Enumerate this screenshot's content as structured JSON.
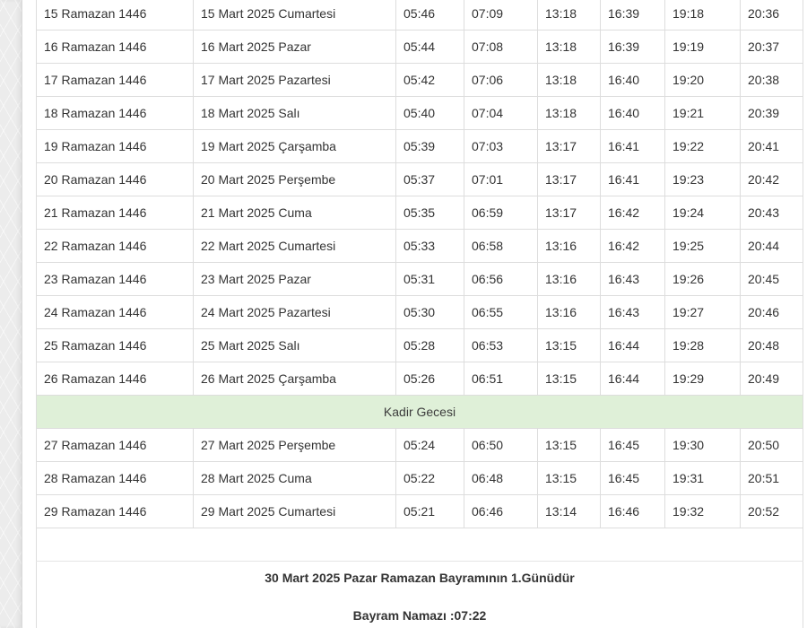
{
  "table": {
    "rows_before_event": [
      [
        "15 Ramazan 1446",
        "15 Mart 2025 Cumartesi",
        "05:46",
        "07:09",
        "13:18",
        "16:39",
        "19:18",
        "20:36"
      ],
      [
        "16 Ramazan 1446",
        "16 Mart 2025 Pazar",
        "05:44",
        "07:08",
        "13:18",
        "16:39",
        "19:19",
        "20:37"
      ],
      [
        "17 Ramazan 1446",
        "17 Mart 2025 Pazartesi",
        "05:42",
        "07:06",
        "13:18",
        "16:40",
        "19:20",
        "20:38"
      ],
      [
        "18 Ramazan 1446",
        "18 Mart 2025 Salı",
        "05:40",
        "07:04",
        "13:18",
        "16:40",
        "19:21",
        "20:39"
      ],
      [
        "19 Ramazan 1446",
        "19 Mart 2025 Çarşamba",
        "05:39",
        "07:03",
        "13:17",
        "16:41",
        "19:22",
        "20:41"
      ],
      [
        "20 Ramazan 1446",
        "20 Mart 2025 Perşembe",
        "05:37",
        "07:01",
        "13:17",
        "16:41",
        "19:23",
        "20:42"
      ],
      [
        "21 Ramazan 1446",
        "21 Mart 2025 Cuma",
        "05:35",
        "06:59",
        "13:17",
        "16:42",
        "19:24",
        "20:43"
      ],
      [
        "22 Ramazan 1446",
        "22 Mart 2025 Cumartesi",
        "05:33",
        "06:58",
        "13:16",
        "16:42",
        "19:25",
        "20:44"
      ],
      [
        "23 Ramazan 1446",
        "23 Mart 2025 Pazar",
        "05:31",
        "06:56",
        "13:16",
        "16:43",
        "19:26",
        "20:45"
      ],
      [
        "24 Ramazan 1446",
        "24 Mart 2025 Pazartesi",
        "05:30",
        "06:55",
        "13:16",
        "16:43",
        "19:27",
        "20:46"
      ],
      [
        "25 Ramazan 1446",
        "25 Mart 2025 Salı",
        "05:28",
        "06:53",
        "13:15",
        "16:44",
        "19:28",
        "20:48"
      ],
      [
        "26 Ramazan 1446",
        "26 Mart 2025 Çarşamba",
        "05:26",
        "06:51",
        "13:15",
        "16:44",
        "19:29",
        "20:49"
      ]
    ],
    "event_label": "Kadir Gecesi",
    "rows_after_event": [
      [
        "27 Ramazan 1446",
        "27 Mart 2025 Perşembe",
        "05:24",
        "06:50",
        "13:15",
        "16:45",
        "19:30",
        "20:50"
      ],
      [
        "28 Ramazan 1446",
        "28 Mart 2025 Cuma",
        "05:22",
        "06:48",
        "13:15",
        "16:45",
        "19:31",
        "20:51"
      ],
      [
        "29 Ramazan 1446",
        "29 Mart 2025 Cumartesi",
        "05:21",
        "06:46",
        "13:14",
        "16:46",
        "19:32",
        "20:52"
      ]
    ]
  },
  "notice": {
    "bayram_line": "30 Mart 2025 Pazar Ramazan Bayramının 1.Günüdür",
    "namaz_line": "Bayram Namazı :07:22"
  },
  "colors": {
    "event_row_bg": "#dff0d8",
    "border": "#dddddd",
    "text": "#333333"
  }
}
